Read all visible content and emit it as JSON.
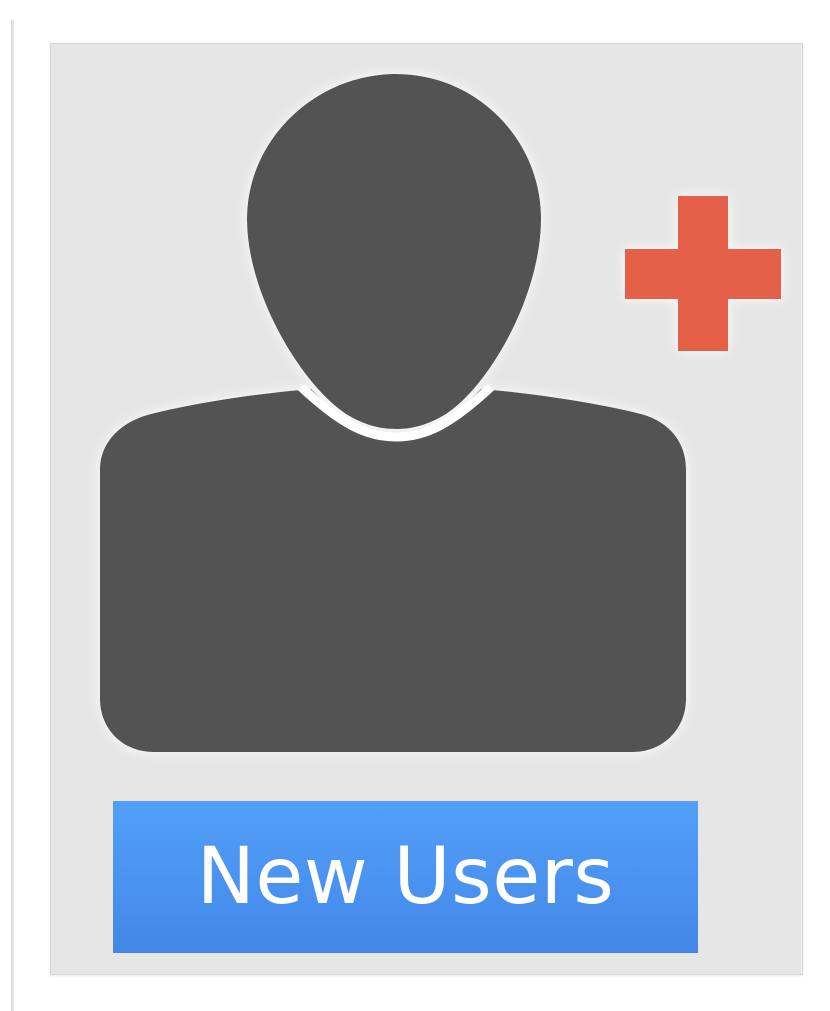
{
  "tile": {
    "label": "New Users",
    "icon": "add-user-icon"
  },
  "colors": {
    "card_background": "#e6e6e6",
    "silhouette": "#535353",
    "plus": "#e4604a",
    "label_background": "#4a91ef",
    "label_text": "#ffffff"
  }
}
